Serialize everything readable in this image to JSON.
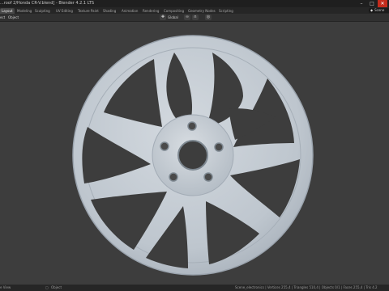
{
  "window": {
    "title": "...roof 2/Honda CR-V.blend] - Blender 4.2.1 LTS",
    "minimize_icon": "minimize-icon",
    "maximize_icon": "maximize-icon",
    "close_icon": "close-icon"
  },
  "workspace_tabs": [
    {
      "label": "Layout",
      "active": true
    },
    {
      "label": "Modeling"
    },
    {
      "label": "Sculpting"
    },
    {
      "label": "UV Editing"
    },
    {
      "label": "Texture Paint"
    },
    {
      "label": "Shading"
    },
    {
      "label": "Animation"
    },
    {
      "label": "Rendering"
    },
    {
      "label": "Compositing"
    },
    {
      "label": "Geometry Nodes"
    },
    {
      "label": "Scripting"
    }
  ],
  "scene": {
    "icon": "scene-icon",
    "label": "Scene"
  },
  "toolbar": {
    "left_label": "ect",
    "object_menu": "Object",
    "transform_orientation": "Global",
    "orientation_icon": "axes-icon",
    "pivot_icon": "link-icon",
    "snap_icon": "magnet-icon",
    "proportional_icon": "proportional-edit-icon"
  },
  "statusbar": {
    "left": "e View",
    "middle_icon": "object-icon",
    "middle_label": "Object",
    "right": "Scene_electronics | Vertices 255,4 | Triangles 510,4 | Objects 0/1 | Faces 255,4 | Tris 4.2"
  },
  "colors": {
    "viewport_bg": "#3d3d3d",
    "wheel_face": "#c6ced6",
    "wheel_shadow": "#8f98a2",
    "window_gap": "#3d3d3d",
    "close_button": "#c42b1c"
  }
}
